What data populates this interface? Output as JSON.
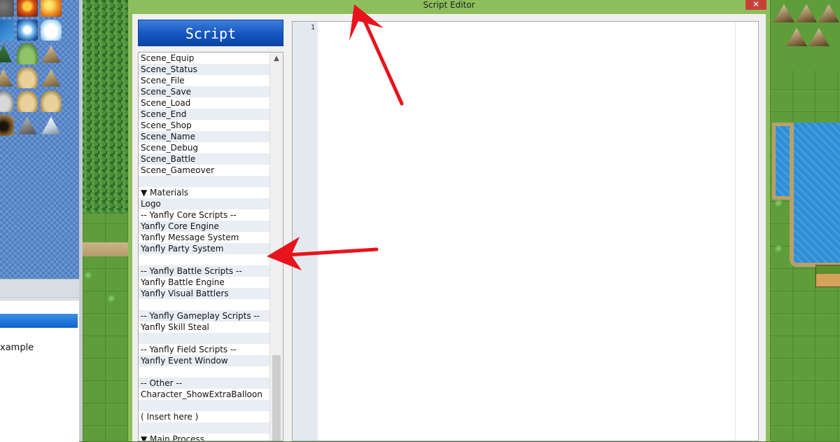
{
  "window": {
    "title": "Script Editor",
    "close_label": "✕"
  },
  "left_panel": {
    "example_text": "xample"
  },
  "script_panel": {
    "header": "Script",
    "items": [
      "Scene_Equip",
      "Scene_Status",
      "Scene_File",
      "Scene_Save",
      "Scene_Load",
      "Scene_End",
      "Scene_Shop",
      "Scene_Name",
      "Scene_Debug",
      "Scene_Battle",
      "Scene_Gameover",
      "",
      "▼ Materials",
      "Logo",
      "-- Yanfly Core Scripts --",
      "Yanfly Core Engine",
      "Yanfly Message System",
      "Yanfly Party System",
      "",
      "-- Yanfly Battle Scripts --",
      "Yanfly Battle Engine",
      "Yanfly Visual Battlers",
      "",
      "-- Yanfly Gameplay Scripts --",
      "Yanfly Skill Steal",
      "",
      "-- Yanfly Field Scripts --",
      "Yanfly Event Window",
      "",
      "-- Other --",
      "Character_ShowExtraBalloon",
      "",
      "( Insert here )",
      "",
      "▼ Main Process"
    ]
  },
  "editor": {
    "line_numbers": [
      "1"
    ]
  },
  "colors": {
    "window_border": "#8cbf5c",
    "header_blue": "#1355bf",
    "arrow_red": "#e8141c"
  },
  "icons": {
    "scroll_up": "▲"
  }
}
